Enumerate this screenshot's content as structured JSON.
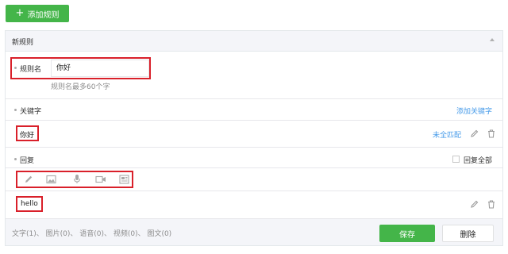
{
  "toolbar": {
    "add_rule_label": "添加规则",
    "add_rule_plus": "+"
  },
  "rule": {
    "header_title": "新规则",
    "name_label": "规则名",
    "name_value": "你好",
    "name_hint": "规则名最多60个字",
    "keyword_label": "关键字",
    "add_keyword_link": "添加关键字",
    "keyword_value": "你好",
    "match_mode_link": "未全匹配",
    "reply_label": "回复",
    "reply_all_label": "回复全部",
    "reply_value": "hello"
  },
  "footer": {
    "counts": "文字(1)、 图片(0)、 语音(0)、 视频(0)、 图文(0)",
    "save_label": "保存",
    "delete_label": "删除"
  },
  "colors": {
    "accent_green": "#44b549",
    "highlight_red": "#d9202a",
    "link_blue": "#459ae9"
  },
  "icons": [
    "plus-icon",
    "chevron-up-icon",
    "edit-icon",
    "delete-icon",
    "pencil-icon",
    "image-icon",
    "microphone-icon",
    "video-icon",
    "news-icon"
  ]
}
